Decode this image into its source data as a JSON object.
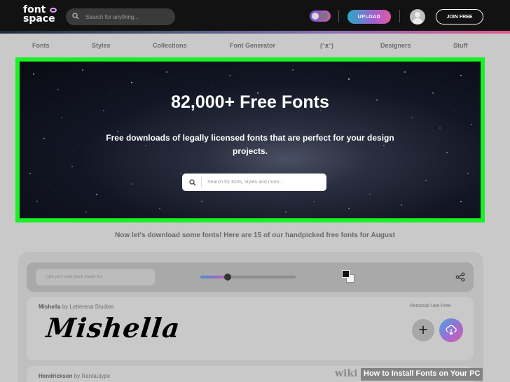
{
  "header": {
    "logo_line1": "font",
    "logo_line2": "space",
    "search_placeholder": "Search for anything...",
    "upload_label": "UPLOAD",
    "join_label": "JOIN FREE"
  },
  "nav": {
    "items": [
      "Fonts",
      "Styles",
      "Collections",
      "Font Generator",
      "(ᵔᴥᵔ)",
      "Designers",
      "Stuff"
    ]
  },
  "hero": {
    "title": "82,000+ Free Fonts",
    "subtitle": "Free downloads of legally licensed fonts that are perfect for your design projects.",
    "search_placeholder": "Search for fonts, styles and more..."
  },
  "tagline": "Now let's download some fonts! Here are 15 of our handpicked free fonts for August",
  "toolbar": {
    "preview_placeholder": "Type your own quick brown fox...",
    "size_slider_fraction": 0.29
  },
  "fonts": [
    {
      "name": "Mishella",
      "by": "by",
      "designer": "Letterena Studios",
      "license": "Personal Use Free",
      "specimen": "Mishella"
    },
    {
      "name": "Hendrickson",
      "by": "by",
      "designer": "Rantautype"
    }
  ],
  "watermark": {
    "brand": "wiki",
    "title": "How to Install Fonts on Your PC"
  },
  "colors": {
    "topbar": "#121212",
    "hero_border": "#19f026",
    "accent_gradient_start": "#2aa9c9",
    "accent_gradient_end": "#e35aa2",
    "page_background": "#c9c9c9"
  },
  "icons": [
    "search-icon",
    "theme-toggle",
    "avatar",
    "share-icon",
    "plus-icon",
    "download-icon",
    "color-swatch"
  ]
}
